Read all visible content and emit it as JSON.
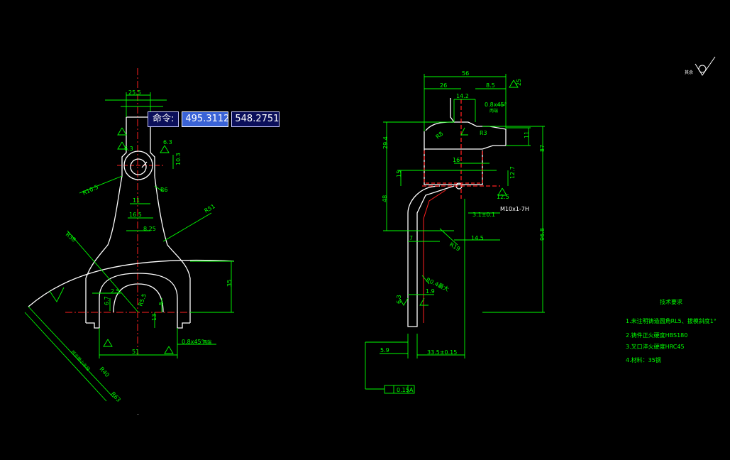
{
  "command": {
    "label": "命令:",
    "x_value": "495.3112",
    "y_value": "548.2751"
  },
  "colors": {
    "background": "#000000",
    "outline": "#ffffff",
    "dimension": "#00ff00",
    "center": "#ff2020",
    "hidden": "#ff2020"
  },
  "left_view_dims": {
    "d_top": "25.5",
    "d_top_tol": "+0.26\n0",
    "d_63a": "6.3",
    "d_63b": "6.3",
    "d_63c": "6.3",
    "d_103": "10.3",
    "r_105": "R10.5",
    "r_63": "R6",
    "r_51": "R51",
    "r_38": "R38",
    "d_11": "11",
    "d_165": "16.5",
    "d_825": "8.25",
    "d_25": "2.5",
    "d_67": "6.7",
    "d_155": "R5.5",
    "d_35": "35",
    "d_5": "5",
    "d_13": "13",
    "d_chamfer": "0.8x45°",
    "d_chamfer_note": "两端",
    "d_51": "51",
    "d_51_tol": "+0.2\n0",
    "r_63b": "R63",
    "r_40": "R40",
    "note_rot": "所示面小半径"
  },
  "right_view_dims": {
    "d_56": "56",
    "d_25": "25",
    "d_26": "26",
    "d_85": "8.5",
    "d_142": "14.2",
    "d_08x45": "0.8x45°",
    "d_08_note": "两端",
    "d_63": "6.3",
    "r_3": "R3",
    "r_8": "R8",
    "d_11": "11",
    "d_87": "87",
    "d_294": "29.4",
    "d_16": "16",
    "d_15": "15",
    "d_127": "12.7",
    "d_125": "12.5",
    "d_48": "48",
    "m10": "M10x1-7H",
    "d_31": "3.1±0.1",
    "d_145": "14.5",
    "d_968": "96.8",
    "r_19": "R19",
    "r_04": "R0.4最大",
    "d_7": "7",
    "d_19": "1.9",
    "d_59": "5.9",
    "d_335": "33.5±0.15",
    "tol_frame": "0.15",
    "tol_datum": "A"
  },
  "roughness_note": "其余",
  "tech_requirements": {
    "title": "技术要求",
    "items": [
      "1.未注明铸造圆角RL5、拔模斜度1°",
      "2.铸件正火硬度HBS180",
      "3.叉口淬火硬度HRC45",
      "4.材料：35钢"
    ]
  }
}
